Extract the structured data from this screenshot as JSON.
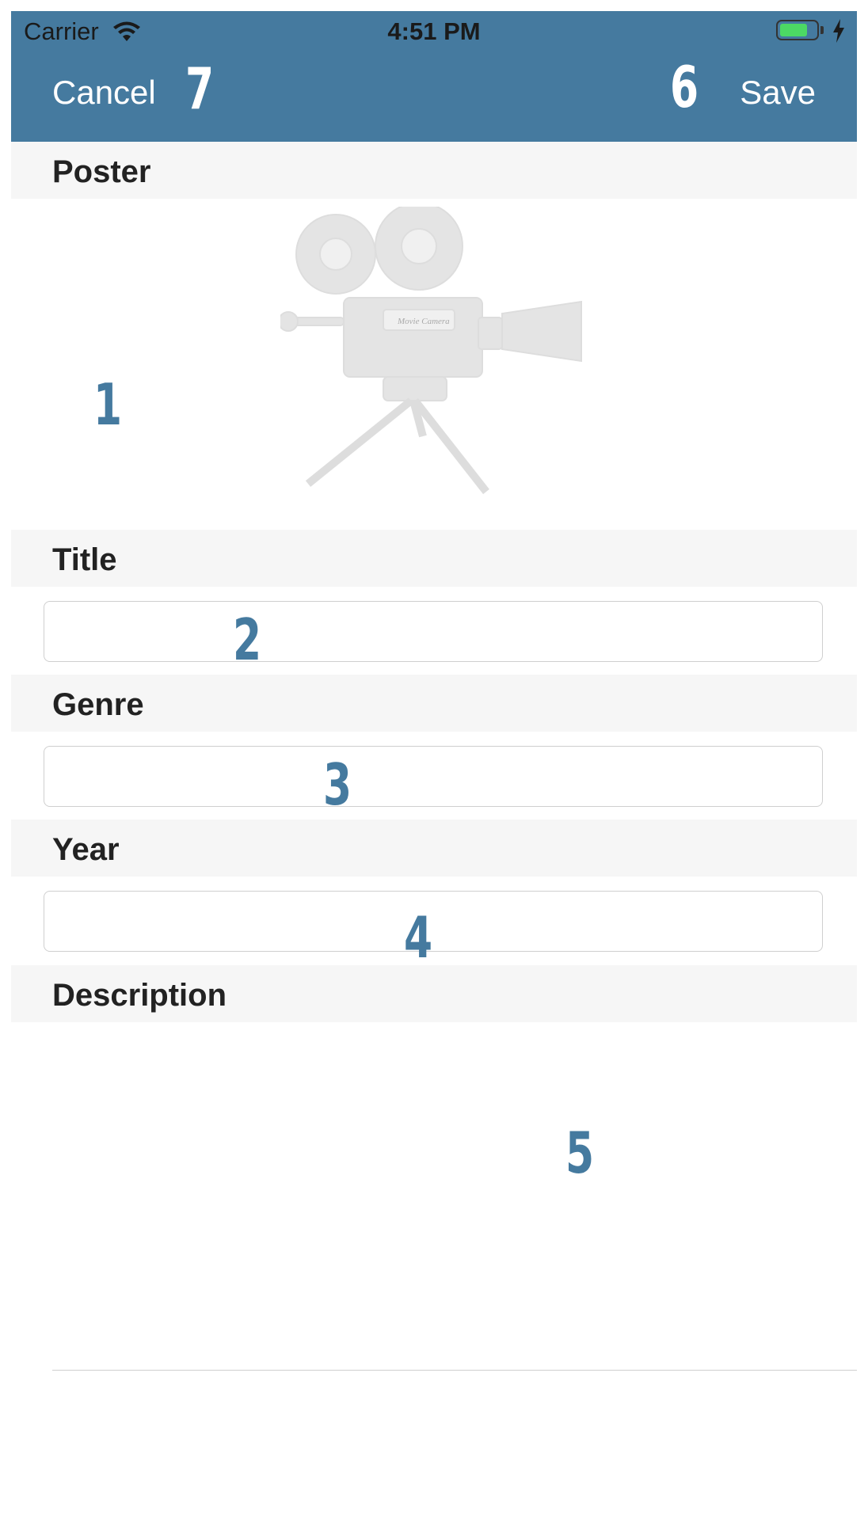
{
  "status_bar": {
    "carrier": "Carrier",
    "time": "4:51 PM"
  },
  "nav_bar": {
    "cancel_label": "Cancel",
    "save_label": "Save",
    "background_color": "#457a9f"
  },
  "markers": {
    "poster": "1",
    "title": "2",
    "genre": "3",
    "year": "4",
    "description": "5",
    "save": "6",
    "cancel": "7"
  },
  "sections": {
    "poster": "Poster",
    "title": "Title",
    "genre": "Genre",
    "year": "Year",
    "description": "Description"
  },
  "fields": {
    "title_value": "",
    "genre_value": "",
    "year_value": "",
    "description_value": ""
  },
  "poster": {
    "icon": "movie-camera-icon",
    "camera_text": "Movie Camera"
  }
}
